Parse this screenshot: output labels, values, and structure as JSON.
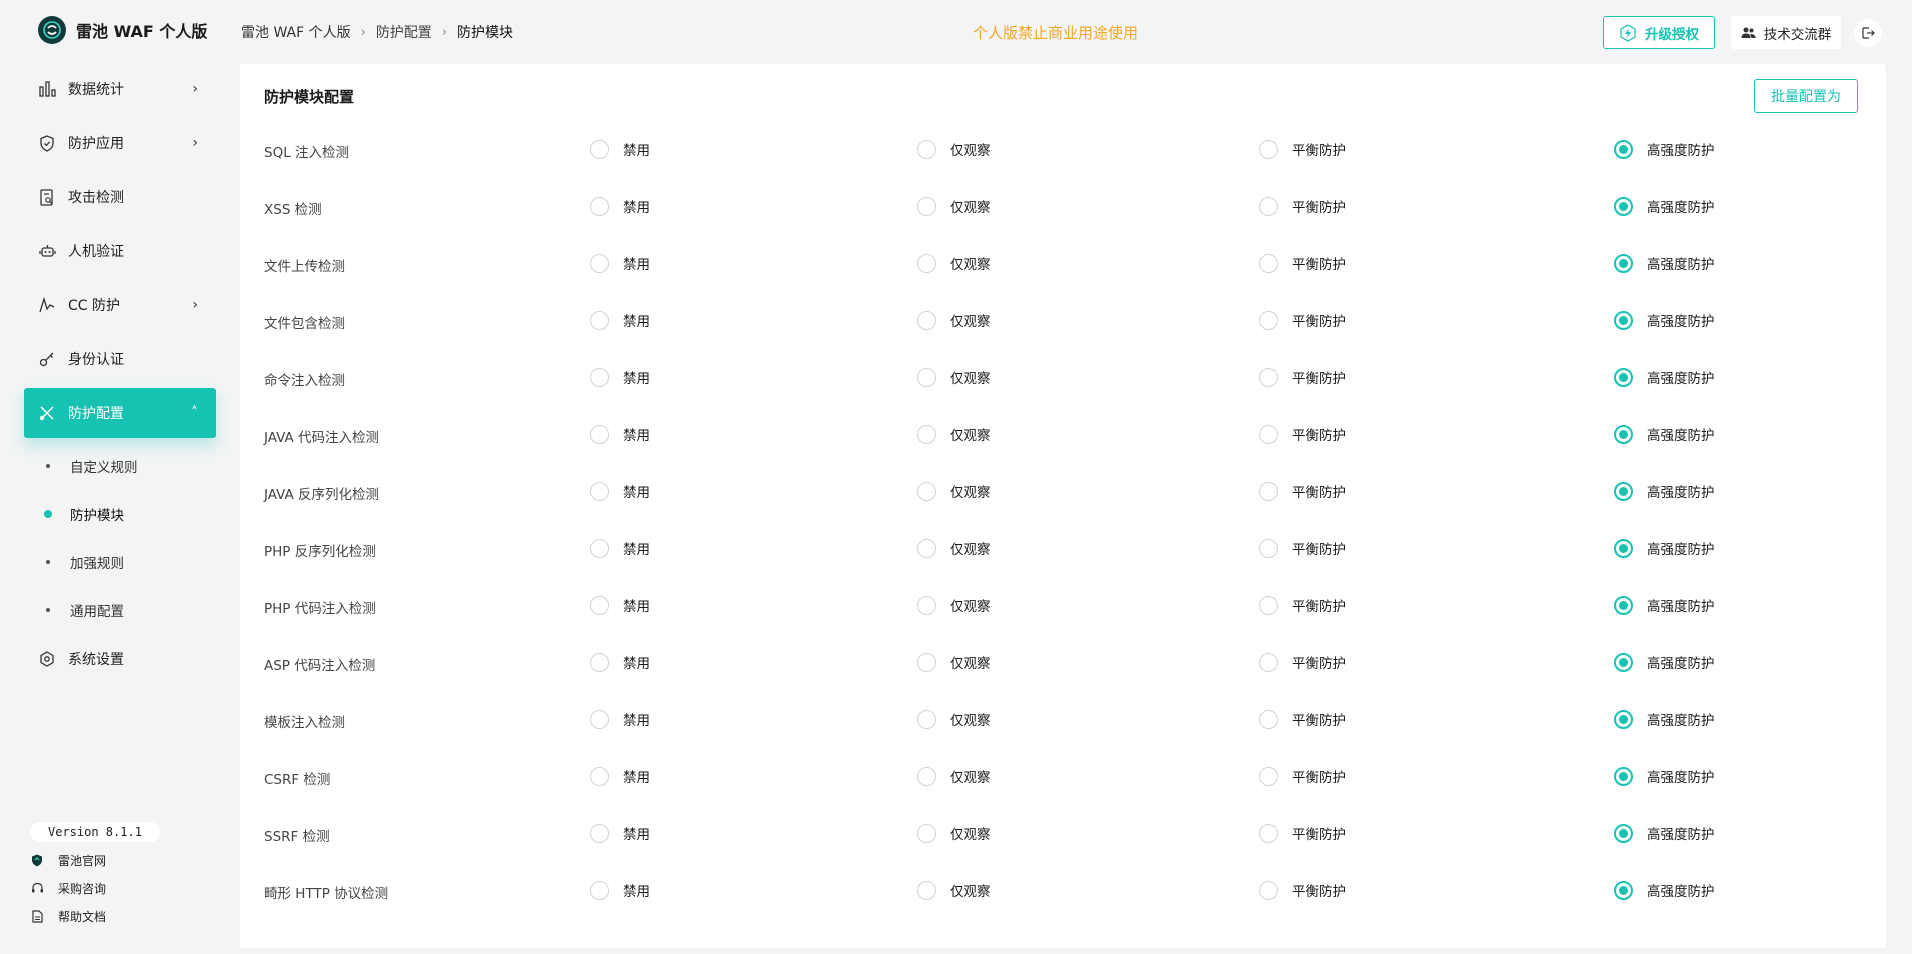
{
  "brand": {
    "title": "雷池 WAF 个人版"
  },
  "nav": {
    "items": [
      {
        "label": "数据统计",
        "icon": "bar-chart-icon",
        "has_chevron": true
      },
      {
        "label": "防护应用",
        "icon": "shield-icon",
        "has_chevron": true
      },
      {
        "label": "攻击检测",
        "icon": "document-search-icon",
        "has_chevron": false
      },
      {
        "label": "人机验证",
        "icon": "robot-icon",
        "has_chevron": false
      },
      {
        "label": "CC 防护",
        "icon": "pulse-icon",
        "has_chevron": true
      },
      {
        "label": "身份认证",
        "icon": "key-icon",
        "has_chevron": false
      },
      {
        "label": "防护配置",
        "icon": "tools-icon",
        "has_chevron": true,
        "active": true
      },
      {
        "label": "系统设置",
        "icon": "settings-icon",
        "has_chevron": false
      }
    ],
    "sub_items": [
      {
        "label": "自定义规则"
      },
      {
        "label": "防护模块",
        "active": true
      },
      {
        "label": "加强规则"
      },
      {
        "label": "通用配置"
      }
    ]
  },
  "footer": {
    "version": "Version 8.1.1",
    "links": [
      {
        "label": "雷池官网",
        "icon": "shield-logo-icon"
      },
      {
        "label": "采购咨询",
        "icon": "headset-icon"
      },
      {
        "label": "帮助文档",
        "icon": "document-icon"
      }
    ]
  },
  "breadcrumb": [
    "雷池 WAF 个人版",
    "防护配置",
    "防护模块"
  ],
  "header": {
    "notice": "个人版禁止商业用途使用",
    "upgrade_label": "升级授权",
    "group_label": "技术交流群"
  },
  "card": {
    "title": "防护模块配置",
    "batch_label": "批量配置为",
    "options": [
      "禁用",
      "仅观察",
      "平衡防护",
      "高强度防护"
    ],
    "rows": [
      {
        "label": "SQL 注入检测",
        "selected": "高强度防护"
      },
      {
        "label": "XSS 检测",
        "selected": "高强度防护"
      },
      {
        "label": "文件上传检测",
        "selected": "高强度防护"
      },
      {
        "label": "文件包含检测",
        "selected": "高强度防护"
      },
      {
        "label": "命令注入检测",
        "selected": "高强度防护"
      },
      {
        "label": "JAVA 代码注入检测",
        "selected": "高强度防护"
      },
      {
        "label": "JAVA 反序列化检测",
        "selected": "高强度防护"
      },
      {
        "label": "PHP 反序列化检测",
        "selected": "高强度防护"
      },
      {
        "label": "PHP 代码注入检测",
        "selected": "高强度防护"
      },
      {
        "label": "ASP 代码注入检测",
        "selected": "高强度防护"
      },
      {
        "label": "模板注入检测",
        "selected": "高强度防护"
      },
      {
        "label": "CSRF 检测",
        "selected": "高强度防护"
      },
      {
        "label": "SSRF 检测",
        "selected": "高强度防护"
      },
      {
        "label": "畸形 HTTP 协议检测",
        "selected": "高强度防护"
      }
    ]
  },
  "colors": {
    "accent": "#16c2b1",
    "notice": "#f5a623",
    "background": "#f2f4f5"
  }
}
